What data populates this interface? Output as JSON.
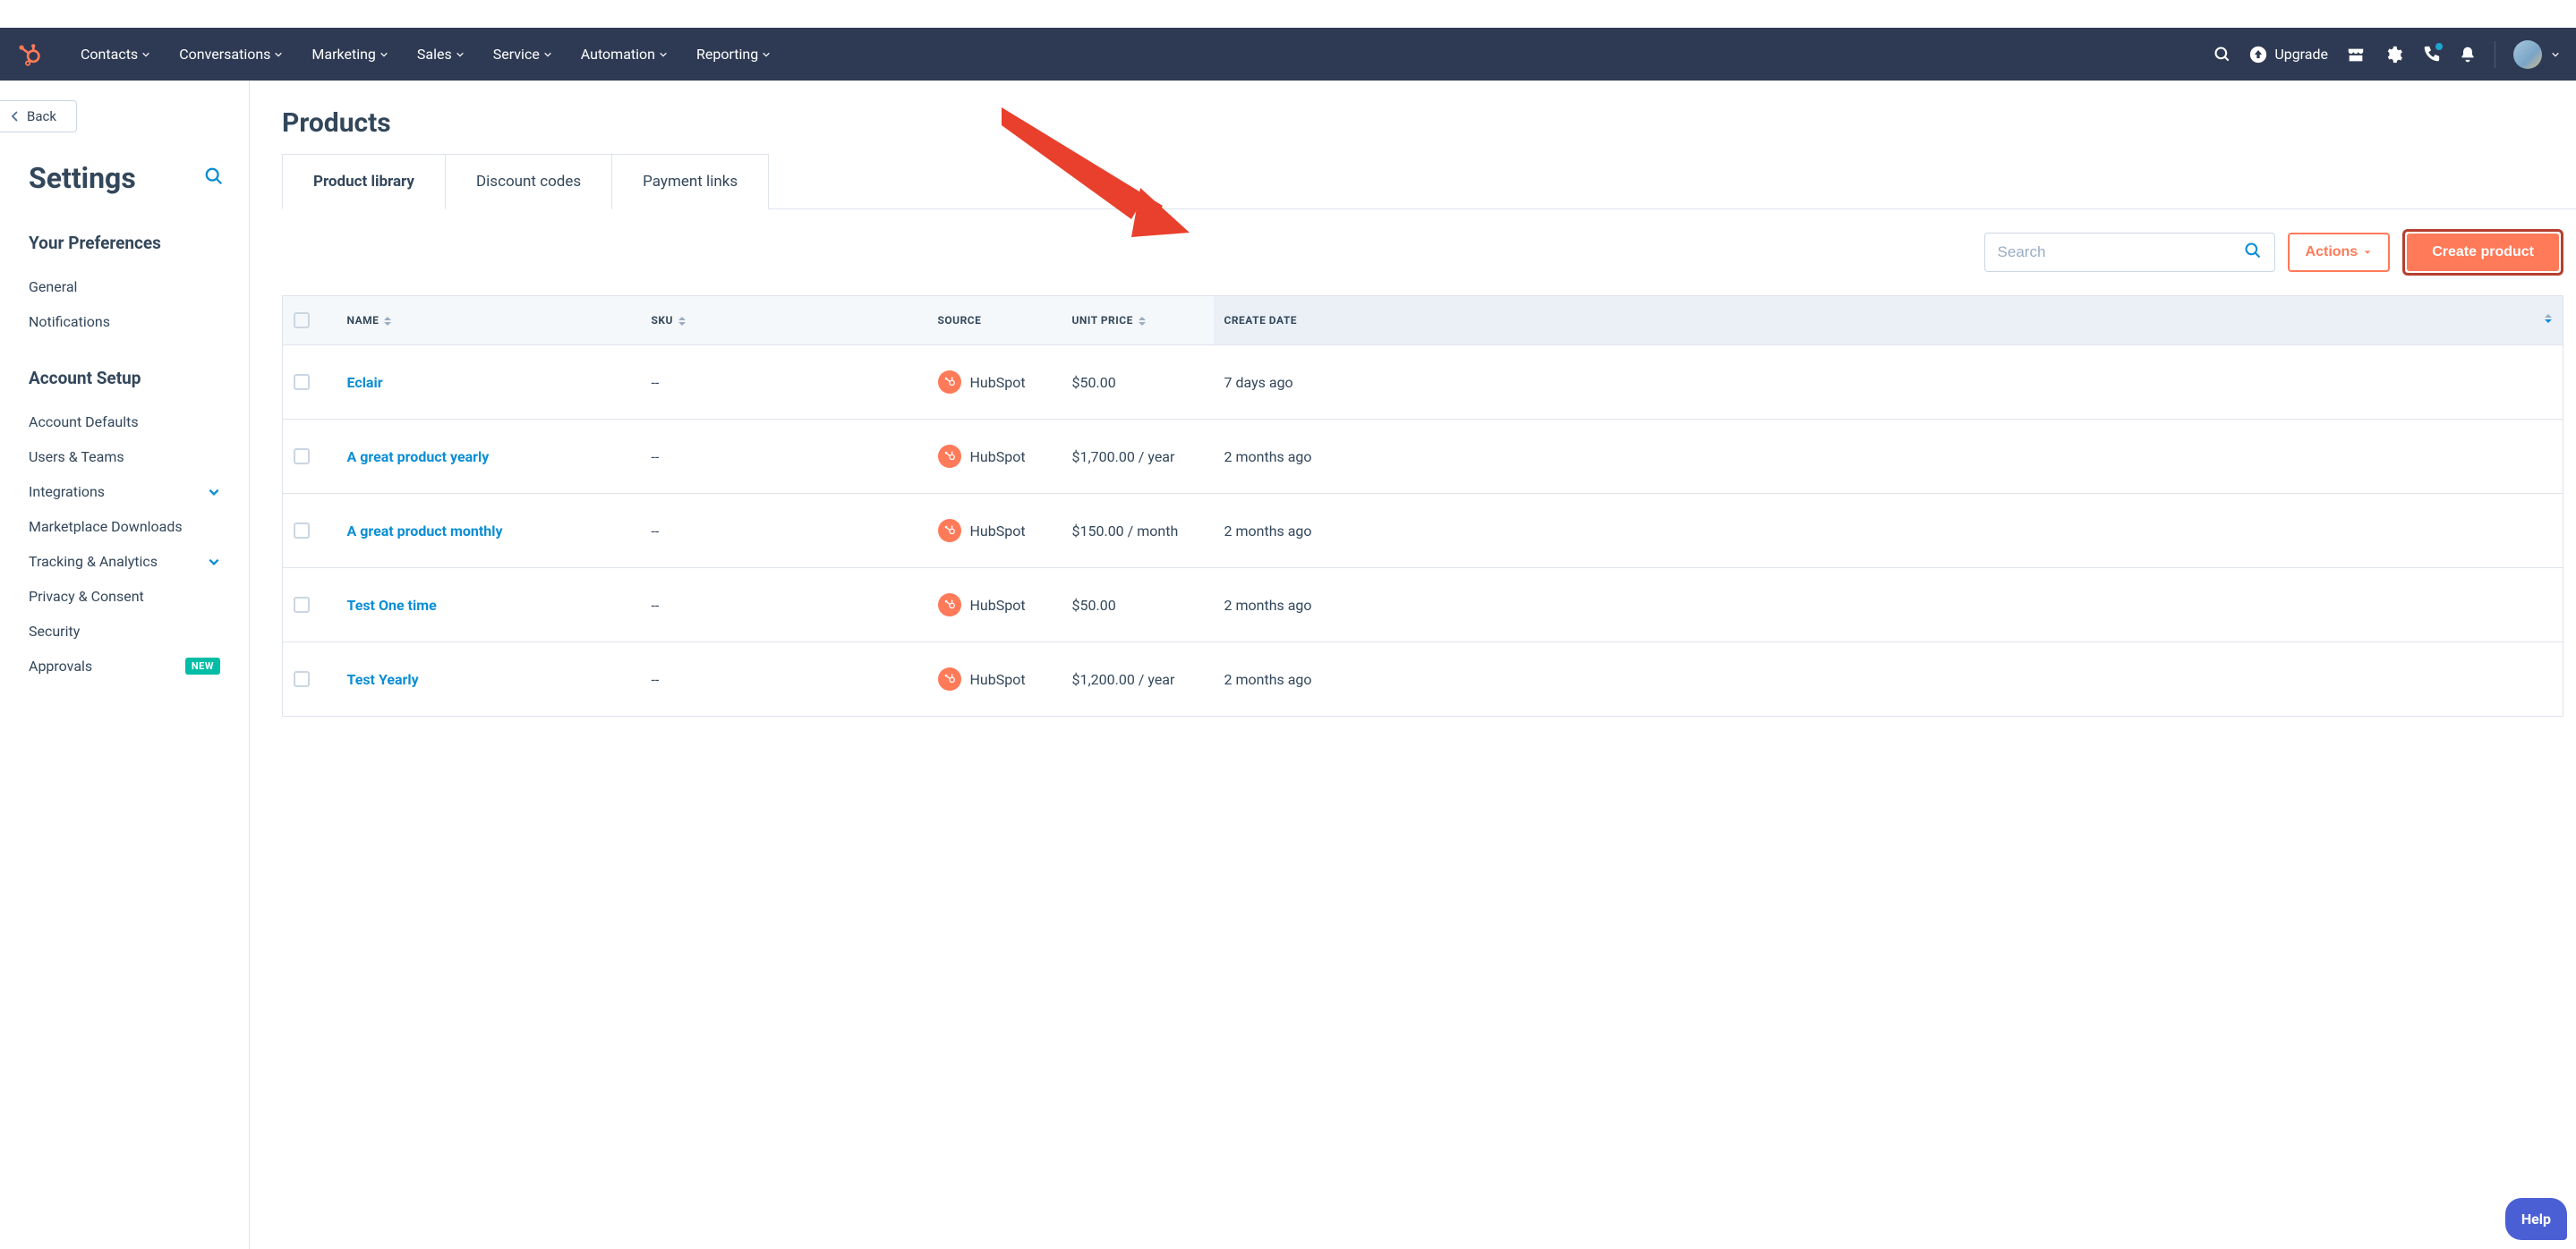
{
  "nav": {
    "items": [
      "Contacts",
      "Conversations",
      "Marketing",
      "Sales",
      "Service",
      "Automation",
      "Reporting"
    ],
    "upgrade": "Upgrade"
  },
  "sidebar": {
    "back": "Back",
    "title": "Settings",
    "section1_title": "Your Preferences",
    "section1": [
      "General",
      "Notifications"
    ],
    "section2_title": "Account Setup",
    "section2": [
      {
        "label": "Account Defaults",
        "expand": false
      },
      {
        "label": "Users & Teams",
        "expand": false
      },
      {
        "label": "Integrations",
        "expand": true
      },
      {
        "label": "Marketplace Downloads",
        "expand": false
      },
      {
        "label": "Tracking & Analytics",
        "expand": true
      },
      {
        "label": "Privacy & Consent",
        "expand": false
      },
      {
        "label": "Security",
        "expand": false
      },
      {
        "label": "Approvals",
        "expand": false,
        "badge": "NEW"
      }
    ]
  },
  "page": {
    "title": "Products",
    "tabs": [
      "Product library",
      "Discount codes",
      "Payment links"
    ],
    "active_tab": 0,
    "search_placeholder": "Search",
    "actions": "Actions",
    "create": "Create product"
  },
  "table": {
    "columns": [
      "NAME",
      "SKU",
      "SOURCE",
      "UNIT PRICE",
      "CREATE DATE"
    ],
    "rows": [
      {
        "name": "Eclair",
        "sku": "--",
        "source": "HubSpot",
        "unit_price": "$50.00",
        "create_date": "7 days ago"
      },
      {
        "name": "A great product yearly",
        "sku": "--",
        "source": "HubSpot",
        "unit_price": "$1,700.00 / year",
        "create_date": "2 months ago"
      },
      {
        "name": "A great product monthly",
        "sku": "--",
        "source": "HubSpot",
        "unit_price": "$150.00 / month",
        "create_date": "2 months ago"
      },
      {
        "name": "Test One time",
        "sku": "--",
        "source": "HubSpot",
        "unit_price": "$50.00",
        "create_date": "2 months ago"
      },
      {
        "name": "Test Yearly",
        "sku": "--",
        "source": "HubSpot",
        "unit_price": "$1,200.00 / year",
        "create_date": "2 months ago"
      }
    ]
  },
  "help": "Help"
}
